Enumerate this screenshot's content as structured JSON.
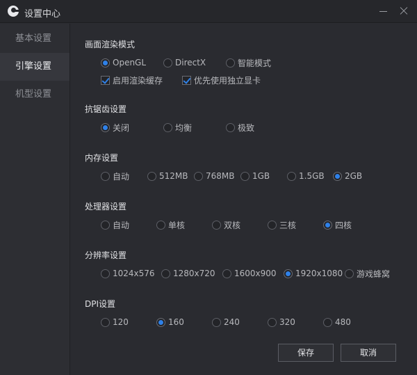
{
  "window": {
    "title": "设置中心"
  },
  "sidebar": {
    "items": [
      {
        "label": "基本设置"
      },
      {
        "label": "引擎设置"
      },
      {
        "label": "机型设置"
      }
    ]
  },
  "render": {
    "title": "画面渲染模式",
    "options": [
      "OpenGL",
      "DirectX",
      "智能模式"
    ],
    "checkboxes": [
      "启用渲染缓存",
      "优先使用独立显卡"
    ]
  },
  "antialias": {
    "title": "抗锯齿设置",
    "options": [
      "关闭",
      "均衡",
      "极致"
    ]
  },
  "memory": {
    "title": "内存设置",
    "options": [
      "自动",
      "512MB",
      "768MB",
      "1GB",
      "1.5GB",
      "2GB"
    ]
  },
  "cpu": {
    "title": "处理器设置",
    "options": [
      "自动",
      "单核",
      "双核",
      "三核",
      "四核"
    ]
  },
  "resolution": {
    "title": "分辨率设置",
    "options": [
      "1024x576",
      "1280x720",
      "1600x900",
      "1920x1080",
      "游戏蜂窝"
    ]
  },
  "dpi": {
    "title": "DPI设置",
    "options": [
      "120",
      "160",
      "240",
      "320",
      "480"
    ]
  },
  "buttons": {
    "save": "保存",
    "cancel": "取消"
  }
}
